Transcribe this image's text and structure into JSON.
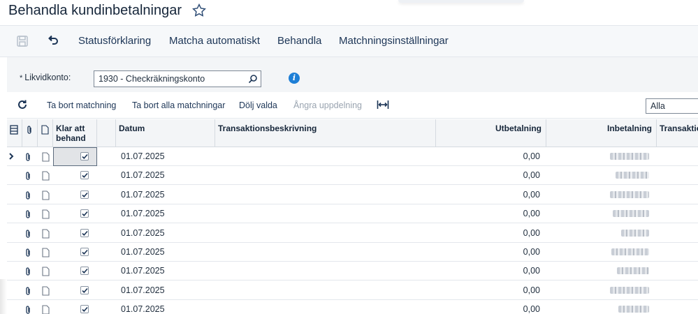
{
  "header": {
    "title": "Behandla kundinbetalningar",
    "favorite_icon": "star-icon"
  },
  "toolbar": {
    "save_icon": "save-icon",
    "undo_icon": "undo-icon",
    "buttons": [
      "Statusförklaring",
      "Matcha automatiskt",
      "Behandla",
      "Matchningsinställningar"
    ]
  },
  "filter": {
    "account_label": "Likvidkonto:",
    "required_marker": "*",
    "account_value": "1930 - Checkräkningskonto",
    "search_icon": "search-icon",
    "info_icon": "info-icon",
    "info_symbol": "i"
  },
  "gridbar": {
    "refresh_icon": "refresh-icon",
    "buttons": [
      "Ta bort matchning",
      "Ta bort alla matchningar",
      "Dölj valda",
      "Ångra uppdelning"
    ],
    "disabled": [
      "Ångra uppdelning"
    ],
    "fit_icon": "fit-columns-icon",
    "filter_value": "Alla"
  },
  "grid": {
    "columns": [
      "",
      "",
      "",
      "Klar att behand",
      "",
      "Datum",
      "Transaktionsbeskrivning",
      "Utbetalning",
      "Inbetalning",
      "Transaktio"
    ],
    "rows": [
      {
        "ready": true,
        "date": "01.07.2025",
        "description": "",
        "payment_out": "0,00",
        "payment_in": "",
        "selected": true
      },
      {
        "ready": true,
        "date": "01.07.2025",
        "description": "",
        "payment_out": "0,00",
        "payment_in": ""
      },
      {
        "ready": true,
        "date": "01.07.2025",
        "description": "",
        "payment_out": "0,00",
        "payment_in": ""
      },
      {
        "ready": true,
        "date": "01.07.2025",
        "description": "",
        "payment_out": "0,00",
        "payment_in": ""
      },
      {
        "ready": true,
        "date": "01.07.2025",
        "description": "",
        "payment_out": "0,00",
        "payment_in": ""
      },
      {
        "ready": true,
        "date": "01.07.2025",
        "description": "",
        "payment_out": "0,00",
        "payment_in": ""
      },
      {
        "ready": true,
        "date": "01.07.2025",
        "description": "",
        "payment_out": "0,00",
        "payment_in": ""
      },
      {
        "ready": true,
        "date": "01.07.2025",
        "description": "",
        "payment_out": "0,00",
        "payment_in": ""
      },
      {
        "ready": true,
        "date": "01.07.2025",
        "description": "",
        "payment_out": "0,00",
        "payment_in": ""
      }
    ]
  },
  "colors": {
    "accent": "#1e7fd6",
    "text": "#1c3556",
    "header_bg": "#f3f5f7"
  }
}
